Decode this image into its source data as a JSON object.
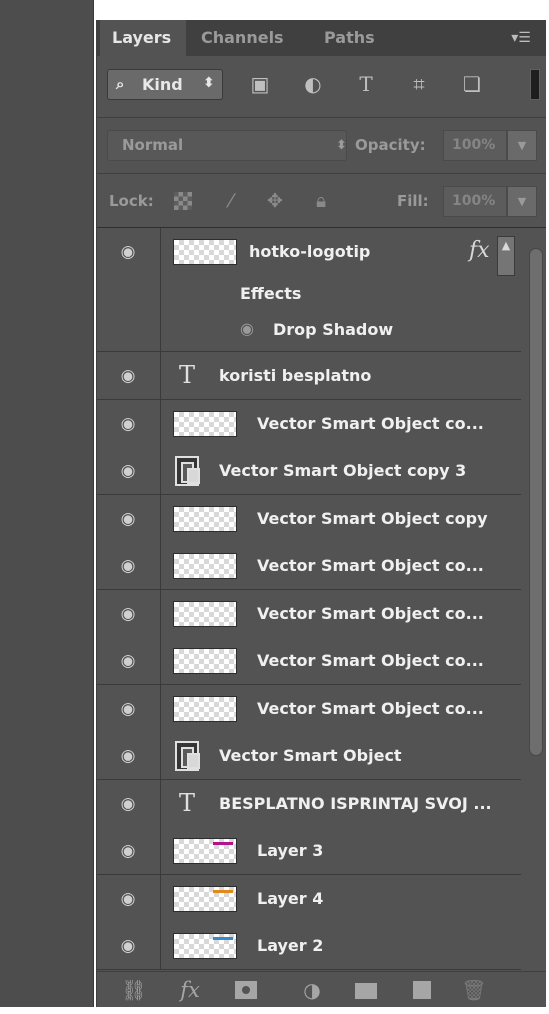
{
  "tabs": {
    "layers": "Layers",
    "channels": "Channels",
    "paths": "Paths"
  },
  "filter": {
    "kind_label": "Kind",
    "filter_icons": [
      "image-filter-icon",
      "adjustment-filter-icon",
      "type-filter-icon",
      "shape-filter-icon",
      "smart-object-filter-icon"
    ]
  },
  "blend": {
    "mode": "Normal",
    "opacity_label": "Opacity:",
    "opacity_value": "100%"
  },
  "lock": {
    "label": "Lock:",
    "fill_label": "Fill:",
    "fill_value": "100%"
  },
  "layers": {
    "first": {
      "name": "hotko-logotip",
      "effects_label": "Effects",
      "effect_name": "Drop Shadow"
    },
    "items": [
      {
        "name": "koristi besplatno",
        "kind": "type"
      },
      {
        "name": "Vector Smart Object co...",
        "kind": "pixel"
      },
      {
        "name": "Vector Smart Object copy 3",
        "kind": "smart"
      },
      {
        "name": "Vector Smart Object copy",
        "kind": "pixel"
      },
      {
        "name": "Vector Smart Object co...",
        "kind": "pixel"
      },
      {
        "name": "Vector Smart Object co...",
        "kind": "pixel"
      },
      {
        "name": "Vector Smart Object co...",
        "kind": "pixel"
      },
      {
        "name": "Vector Smart Object co...",
        "kind": "pixel"
      },
      {
        "name": "Vector Smart Object",
        "kind": "smart"
      },
      {
        "name": "BESPLATNO ISPRINTAJ SVOJ ...",
        "kind": "type"
      },
      {
        "name": "Layer 3",
        "kind": "pixel",
        "mark_color": "#b0148c"
      },
      {
        "name": "Layer 4",
        "kind": "pixel",
        "mark_color": "#e08a1e"
      },
      {
        "name": "Layer 2",
        "kind": "pixel",
        "mark_color": "#3a88c8"
      }
    ]
  },
  "footer_icons": [
    "link-icon",
    "fx-icon",
    "mask-icon",
    "adjustment-icon",
    "group-folder-icon",
    "new-layer-icon",
    "trash-icon"
  ],
  "colors": {
    "panel_bg": "#535353",
    "dock_bg": "#4d4d4d",
    "tab_bar_bg": "#404040"
  }
}
